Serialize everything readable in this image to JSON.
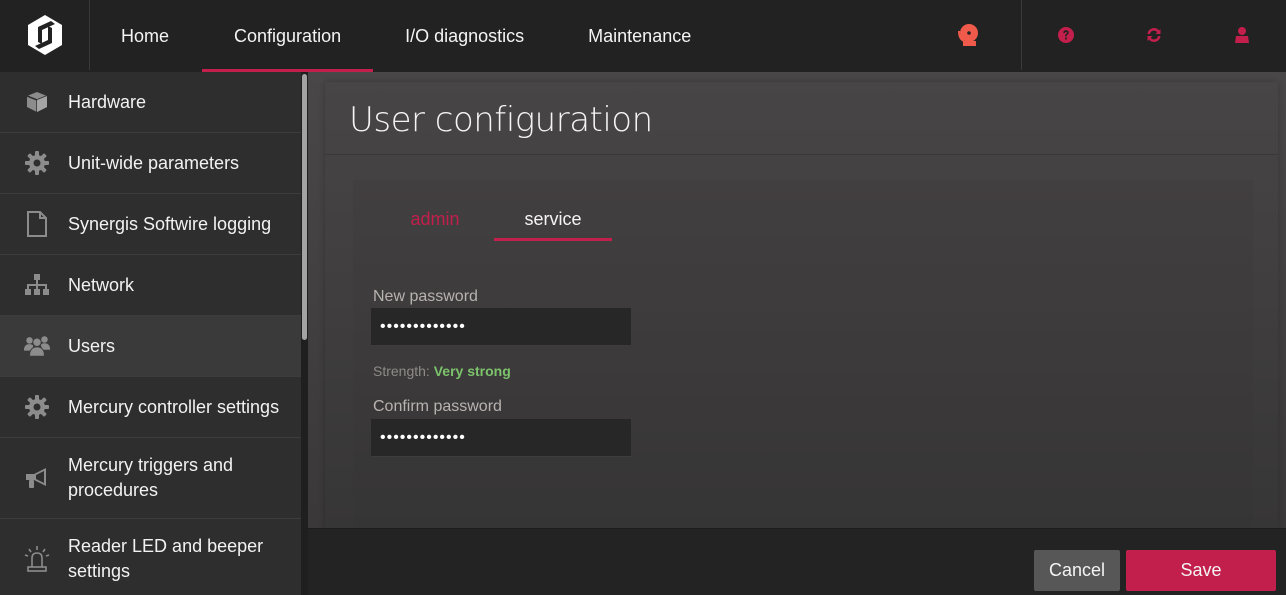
{
  "header": {
    "logo": "genetec-logo-icon",
    "nav": [
      {
        "label": "Home",
        "active": false
      },
      {
        "label": "Configuration",
        "active": true
      },
      {
        "label": "I/O diagnostics",
        "active": false
      },
      {
        "label": "Maintenance",
        "active": false
      }
    ],
    "icons": [
      {
        "name": "alarm-bell-icon",
        "color": "#f05a4a"
      },
      {
        "name": "help-icon",
        "color": "#c21f4c"
      },
      {
        "name": "refresh-icon",
        "color": "#c21f4c"
      },
      {
        "name": "user-icon",
        "color": "#c21f4c"
      }
    ]
  },
  "sidebar": {
    "items": [
      {
        "label": "Hardware",
        "icon": "cube-icon"
      },
      {
        "label": "Unit-wide parameters",
        "icon": "gear-icon"
      },
      {
        "label": "Synergis Softwire logging",
        "icon": "file-icon"
      },
      {
        "label": "Network",
        "icon": "network-icon"
      },
      {
        "label": "Users",
        "icon": "users-icon",
        "active": true
      },
      {
        "label": "Mercury controller settings",
        "icon": "gear-icon"
      },
      {
        "label": "Mercury triggers and procedures",
        "icon": "megaphone-icon"
      },
      {
        "label": "Reader LED and beeper settings",
        "icon": "beacon-icon"
      }
    ]
  },
  "main": {
    "title": "User configuration",
    "tabs": [
      {
        "label": "admin",
        "active": false
      },
      {
        "label": "service",
        "active": true
      }
    ],
    "new_password": {
      "label": "New password",
      "value": "•••••••••••••"
    },
    "strength": {
      "label": "Strength:",
      "value": "Very strong",
      "color": "#7cc36b"
    },
    "confirm_password": {
      "label": "Confirm password",
      "value": "•••••••••••••"
    }
  },
  "footer": {
    "cancel_label": "Cancel",
    "save_label": "Save"
  },
  "colors": {
    "accent": "#c21f4c",
    "background": "#232323",
    "sidebar": "#2e2e2e"
  }
}
